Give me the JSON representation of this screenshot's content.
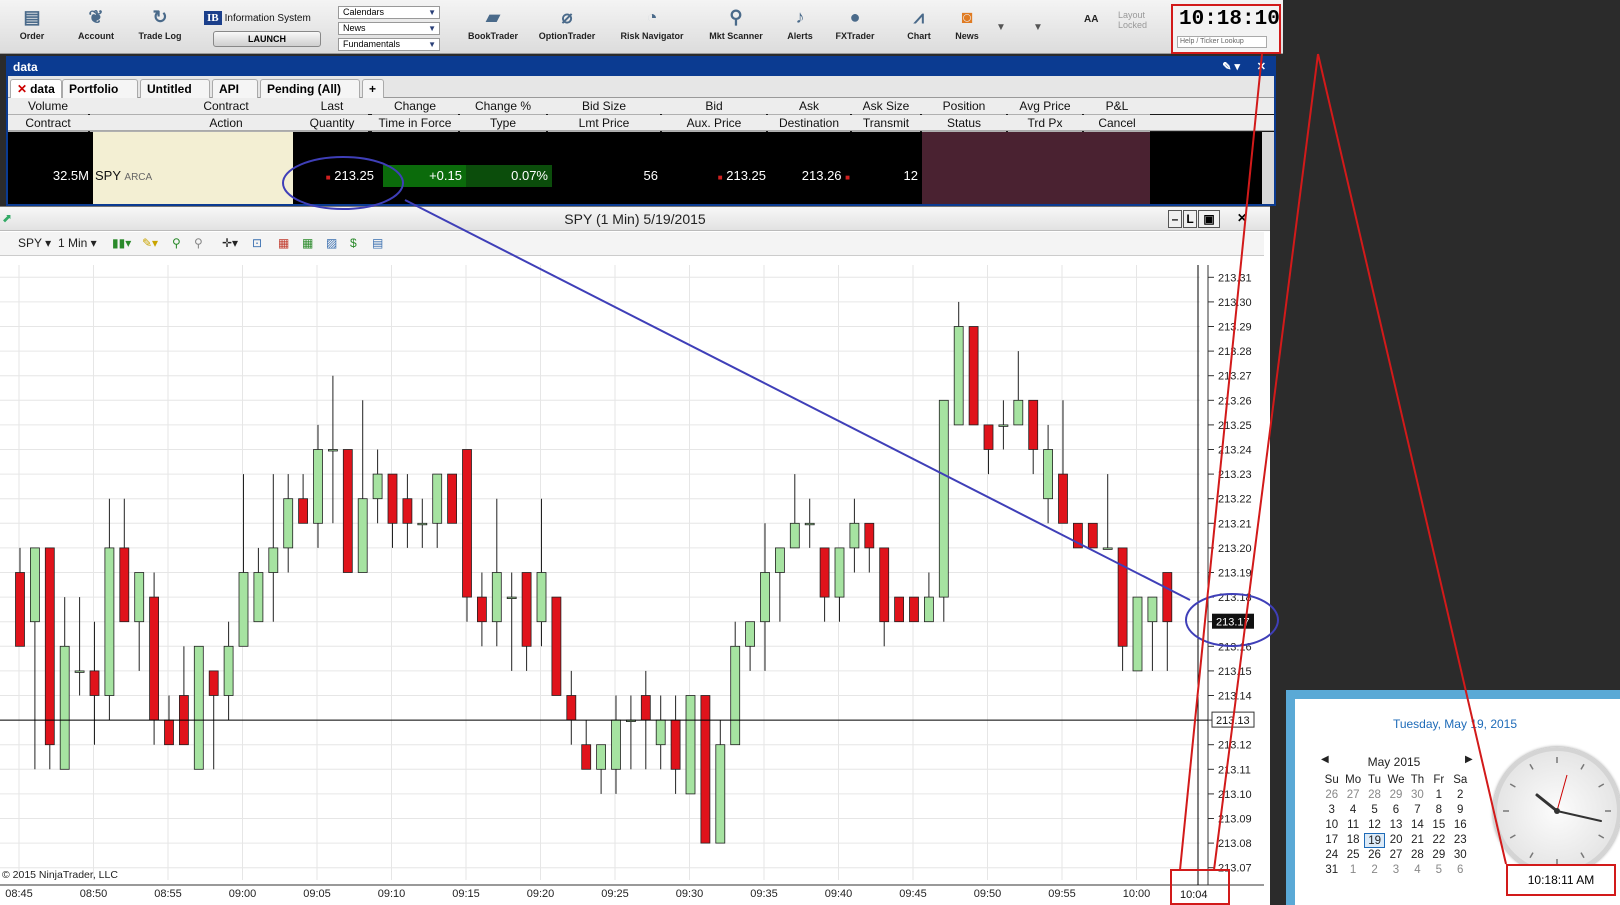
{
  "toolbar": {
    "buttons": [
      {
        "label": "Order",
        "icon": "order-icon"
      },
      {
        "label": "Account",
        "icon": "account-icon"
      },
      {
        "label": "Trade Log",
        "icon": "trade-log-icon"
      },
      {
        "label": "BookTrader",
        "icon": "booktrader-icon"
      },
      {
        "label": "OptionTrader",
        "icon": "optiontrader-icon"
      },
      {
        "label": "Risk Navigator",
        "icon": "risk-navigator-icon"
      },
      {
        "label": "Mkt Scanner",
        "icon": "mkt-scanner-icon"
      },
      {
        "label": "Alerts",
        "icon": "alerts-icon"
      },
      {
        "label": "FXTrader",
        "icon": "fxtrader-icon"
      },
      {
        "label": "Chart",
        "icon": "chart-icon"
      },
      {
        "label": "News",
        "icon": "news-icon"
      }
    ],
    "ib_logo": "IB",
    "ib_info": "Information System",
    "launch": "LAUNCH",
    "dropdowns": [
      "Calendars",
      "News",
      "Fundamentals"
    ],
    "aa": "AA",
    "layout_locked": "Layout\nLocked",
    "clock": "10:18:10",
    "ticker_lookup_placeholder": "Help / Ticker Lookup"
  },
  "data_window": {
    "title": "data",
    "tabs": [
      "data",
      "Portfolio",
      "Untitled",
      "API",
      "Pending (All)",
      "+"
    ],
    "header_row1": [
      "Volume",
      "Contract",
      "Last",
      "Change",
      "Change %",
      "Bid Size",
      "Bid",
      "Ask",
      "Ask Size",
      "Position",
      "Avg Price",
      "P&L"
    ],
    "header_row2": [
      "Contract",
      "Action",
      "Quantity",
      "Time in Force",
      "Type",
      "Lmt Price",
      "Aux. Price",
      "Destination",
      "Transmit",
      "Status",
      "Trd Px",
      "Cancel"
    ],
    "row": {
      "volume": "32.5M",
      "symbol": "SPY",
      "exchange": "ARCA",
      "last": "213.25",
      "change": "+0.15",
      "change_pct": "0.07%",
      "bid_size": "56",
      "bid": "213.25",
      "ask": "213.26",
      "ask_size": "12"
    }
  },
  "chart_window": {
    "title": "SPY (1 Min)  5/19/2015",
    "symbol_select": "SPY",
    "interval_select": "1 Min",
    "copyright": "© 2015 NinjaTrader, LLC",
    "last_price_label": "213.17",
    "crosshair_price_label": "213.13",
    "crosshair_time_label": "10:04"
  },
  "chart_data": {
    "type": "candlestick",
    "title": "SPY (1 Min)  5/19/2015",
    "y_ticks": [
      "213.07",
      "213.08",
      "213.09",
      "213.10",
      "213.11",
      "213.12",
      "213.13",
      "213.14",
      "213.15",
      "213.16",
      "213.17",
      "213.18",
      "213.19",
      "213.20",
      "213.21",
      "213.22",
      "213.23",
      "213.24",
      "213.25",
      "213.26",
      "213.27",
      "213.28",
      "213.29",
      "213.30",
      "213.31"
    ],
    "ylim": [
      213.065,
      213.315
    ],
    "x_ticks": [
      "08:45",
      "08:50",
      "08:55",
      "09:00",
      "09:05",
      "09:10",
      "09:15",
      "09:20",
      "09:25",
      "09:30",
      "09:35",
      "09:40",
      "09:45",
      "09:50",
      "09:55",
      "10:00"
    ],
    "candles": [
      {
        "t": 0,
        "o": 213.19,
        "h": 213.2,
        "l": 213.16,
        "c": 213.16
      },
      {
        "t": 1,
        "o": 213.17,
        "h": 213.2,
        "l": 213.11,
        "c": 213.2
      },
      {
        "t": 2,
        "o": 213.2,
        "h": 213.2,
        "l": 213.11,
        "c": 213.12
      },
      {
        "t": 3,
        "o": 213.11,
        "h": 213.18,
        "l": 213.11,
        "c": 213.16
      },
      {
        "t": 4,
        "o": 213.15,
        "h": 213.18,
        "l": 213.14,
        "c": 213.15
      },
      {
        "t": 5,
        "o": 213.15,
        "h": 213.17,
        "l": 213.12,
        "c": 213.14
      },
      {
        "t": 6,
        "o": 213.14,
        "h": 213.22,
        "l": 213.13,
        "c": 213.2
      },
      {
        "t": 7,
        "o": 213.2,
        "h": 213.22,
        "l": 213.17,
        "c": 213.17
      },
      {
        "t": 8,
        "o": 213.17,
        "h": 213.19,
        "l": 213.15,
        "c": 213.19
      },
      {
        "t": 9,
        "o": 213.18,
        "h": 213.19,
        "l": 213.12,
        "c": 213.13
      },
      {
        "t": 10,
        "o": 213.13,
        "h": 213.14,
        "l": 213.12,
        "c": 213.12
      },
      {
        "t": 11,
        "o": 213.14,
        "h": 213.16,
        "l": 213.12,
        "c": 213.12
      },
      {
        "t": 12,
        "o": 213.11,
        "h": 213.16,
        "l": 213.11,
        "c": 213.16
      },
      {
        "t": 13,
        "o": 213.15,
        "h": 213.15,
        "l": 213.11,
        "c": 213.14
      },
      {
        "t": 14,
        "o": 213.14,
        "h": 213.17,
        "l": 213.13,
        "c": 213.16
      },
      {
        "t": 15,
        "o": 213.16,
        "h": 213.23,
        "l": 213.16,
        "c": 213.19
      },
      {
        "t": 16,
        "o": 213.17,
        "h": 213.2,
        "l": 213.17,
        "c": 213.19
      },
      {
        "t": 17,
        "o": 213.19,
        "h": 213.23,
        "l": 213.17,
        "c": 213.2
      },
      {
        "t": 18,
        "o": 213.2,
        "h": 213.23,
        "l": 213.19,
        "c": 213.22
      },
      {
        "t": 19,
        "o": 213.22,
        "h": 213.23,
        "l": 213.21,
        "c": 213.21
      },
      {
        "t": 20,
        "o": 213.21,
        "h": 213.25,
        "l": 213.2,
        "c": 213.24
      },
      {
        "t": 21,
        "o": 213.24,
        "h": 213.27,
        "l": 213.21,
        "c": 213.24
      },
      {
        "t": 22,
        "o": 213.24,
        "h": 213.24,
        "l": 213.19,
        "c": 213.19
      },
      {
        "t": 23,
        "o": 213.19,
        "h": 213.26,
        "l": 213.19,
        "c": 213.22
      },
      {
        "t": 24,
        "o": 213.22,
        "h": 213.24,
        "l": 213.21,
        "c": 213.23
      },
      {
        "t": 25,
        "o": 213.23,
        "h": 213.23,
        "l": 213.2,
        "c": 213.21
      },
      {
        "t": 26,
        "o": 213.22,
        "h": 213.23,
        "l": 213.2,
        "c": 213.21
      },
      {
        "t": 27,
        "o": 213.21,
        "h": 213.22,
        "l": 213.2,
        "c": 213.21
      },
      {
        "t": 28,
        "o": 213.21,
        "h": 213.23,
        "l": 213.2,
        "c": 213.23
      },
      {
        "t": 29,
        "o": 213.23,
        "h": 213.23,
        "l": 213.21,
        "c": 213.21
      },
      {
        "t": 30,
        "o": 213.24,
        "h": 213.24,
        "l": 213.17,
        "c": 213.18
      },
      {
        "t": 31,
        "o": 213.18,
        "h": 213.19,
        "l": 213.16,
        "c": 213.17
      },
      {
        "t": 32,
        "o": 213.17,
        "h": 213.22,
        "l": 213.16,
        "c": 213.19
      },
      {
        "t": 33,
        "o": 213.18,
        "h": 213.19,
        "l": 213.15,
        "c": 213.18
      },
      {
        "t": 34,
        "o": 213.19,
        "h": 213.19,
        "l": 213.15,
        "c": 213.16
      },
      {
        "t": 35,
        "o": 213.17,
        "h": 213.22,
        "l": 213.16,
        "c": 213.19
      },
      {
        "t": 36,
        "o": 213.18,
        "h": 213.18,
        "l": 213.14,
        "c": 213.14
      },
      {
        "t": 37,
        "o": 213.14,
        "h": 213.15,
        "l": 213.12,
        "c": 213.13
      },
      {
        "t": 38,
        "o": 213.12,
        "h": 213.13,
        "l": 213.11,
        "c": 213.11
      },
      {
        "t": 39,
        "o": 213.11,
        "h": 213.12,
        "l": 213.1,
        "c": 213.12
      },
      {
        "t": 40,
        "o": 213.11,
        "h": 213.14,
        "l": 213.1,
        "c": 213.13
      },
      {
        "t": 41,
        "o": 213.13,
        "h": 213.14,
        "l": 213.11,
        "c": 213.13
      },
      {
        "t": 42,
        "o": 213.14,
        "h": 213.15,
        "l": 213.11,
        "c": 213.13
      },
      {
        "t": 43,
        "o": 213.12,
        "h": 213.14,
        "l": 213.11,
        "c": 213.13
      },
      {
        "t": 44,
        "o": 213.13,
        "h": 213.14,
        "l": 213.1,
        "c": 213.11
      },
      {
        "t": 45,
        "o": 213.1,
        "h": 213.14,
        "l": 213.1,
        "c": 213.14
      },
      {
        "t": 46,
        "o": 213.14,
        "h": 213.14,
        "l": 213.08,
        "c": 213.08
      },
      {
        "t": 47,
        "o": 213.08,
        "h": 213.13,
        "l": 213.08,
        "c": 213.12
      },
      {
        "t": 48,
        "o": 213.12,
        "h": 213.17,
        "l": 213.12,
        "c": 213.16
      },
      {
        "t": 49,
        "o": 213.16,
        "h": 213.17,
        "l": 213.15,
        "c": 213.17
      },
      {
        "t": 50,
        "o": 213.17,
        "h": 213.21,
        "l": 213.15,
        "c": 213.19
      },
      {
        "t": 51,
        "o": 213.19,
        "h": 213.2,
        "l": 213.17,
        "c": 213.2
      },
      {
        "t": 52,
        "o": 213.2,
        "h": 213.23,
        "l": 213.2,
        "c": 213.21
      },
      {
        "t": 53,
        "o": 213.21,
        "h": 213.22,
        "l": 213.2,
        "c": 213.21
      },
      {
        "t": 54,
        "o": 213.2,
        "h": 213.2,
        "l": 213.17,
        "c": 213.18
      },
      {
        "t": 55,
        "o": 213.18,
        "h": 213.2,
        "l": 213.17,
        "c": 213.2
      },
      {
        "t": 56,
        "o": 213.2,
        "h": 213.22,
        "l": 213.19,
        "c": 213.21
      },
      {
        "t": 57,
        "o": 213.21,
        "h": 213.21,
        "l": 213.19,
        "c": 213.2
      },
      {
        "t": 58,
        "o": 213.2,
        "h": 213.2,
        "l": 213.16,
        "c": 213.17
      },
      {
        "t": 59,
        "o": 213.18,
        "h": 213.18,
        "l": 213.17,
        "c": 213.17
      },
      {
        "t": 60,
        "o": 213.18,
        "h": 213.18,
        "l": 213.17,
        "c": 213.17
      },
      {
        "t": 61,
        "o": 213.17,
        "h": 213.19,
        "l": 213.17,
        "c": 213.18
      },
      {
        "t": 62,
        "o": 213.18,
        "h": 213.26,
        "l": 213.17,
        "c": 213.26
      },
      {
        "t": 63,
        "o": 213.25,
        "h": 213.3,
        "l": 213.25,
        "c": 213.29
      },
      {
        "t": 64,
        "o": 213.29,
        "h": 213.29,
        "l": 213.25,
        "c": 213.25
      },
      {
        "t": 65,
        "o": 213.25,
        "h": 213.25,
        "l": 213.23,
        "c": 213.24
      },
      {
        "t": 66,
        "o": 213.25,
        "h": 213.26,
        "l": 213.24,
        "c": 213.25
      },
      {
        "t": 67,
        "o": 213.25,
        "h": 213.28,
        "l": 213.25,
        "c": 213.26
      },
      {
        "t": 68,
        "o": 213.26,
        "h": 213.26,
        "l": 213.23,
        "c": 213.24
      },
      {
        "t": 69,
        "o": 213.22,
        "h": 213.25,
        "l": 213.21,
        "c": 213.24
      },
      {
        "t": 70,
        "o": 213.23,
        "h": 213.26,
        "l": 213.21,
        "c": 213.21
      },
      {
        "t": 71,
        "o": 213.21,
        "h": 213.21,
        "l": 213.2,
        "c": 213.2
      },
      {
        "t": 72,
        "o": 213.21,
        "h": 213.21,
        "l": 213.2,
        "c": 213.2
      },
      {
        "t": 73,
        "o": 213.2,
        "h": 213.23,
        "l": 213.2,
        "c": 213.2
      },
      {
        "t": 74,
        "o": 213.2,
        "h": 213.2,
        "l": 213.15,
        "c": 213.16
      },
      {
        "t": 75,
        "o": 213.15,
        "h": 213.18,
        "l": 213.15,
        "c": 213.18
      },
      {
        "t": 76,
        "o": 213.17,
        "h": 213.18,
        "l": 213.15,
        "c": 213.18
      },
      {
        "t": 77,
        "o": 213.19,
        "h": 213.19,
        "l": 213.15,
        "c": 213.17
      }
    ]
  },
  "calendar": {
    "long_date": "Tuesday, May 19, 2015",
    "month": "May 2015",
    "weekdays": [
      "Su",
      "Mo",
      "Tu",
      "We",
      "Th",
      "Fr",
      "Sa"
    ],
    "weeks": [
      [
        "26",
        "27",
        "28",
        "29",
        "30",
        "1",
        "2"
      ],
      [
        "3",
        "4",
        "5",
        "6",
        "7",
        "8",
        "9"
      ],
      [
        "10",
        "11",
        "12",
        "13",
        "14",
        "15",
        "16"
      ],
      [
        "17",
        "18",
        "19",
        "20",
        "21",
        "22",
        "23"
      ],
      [
        "24",
        "25",
        "26",
        "27",
        "28",
        "29",
        "30"
      ],
      [
        "31",
        "1",
        "2",
        "3",
        "4",
        "5",
        "6"
      ]
    ],
    "today": "19",
    "time": "10:18:11 AM"
  },
  "colors": {
    "up": "#a6e3a1",
    "down": "#e0131b",
    "annotation_blue": "#3f3fb8",
    "annotation_red": "#d21a1a",
    "tws_blue": "#0b3b91"
  }
}
